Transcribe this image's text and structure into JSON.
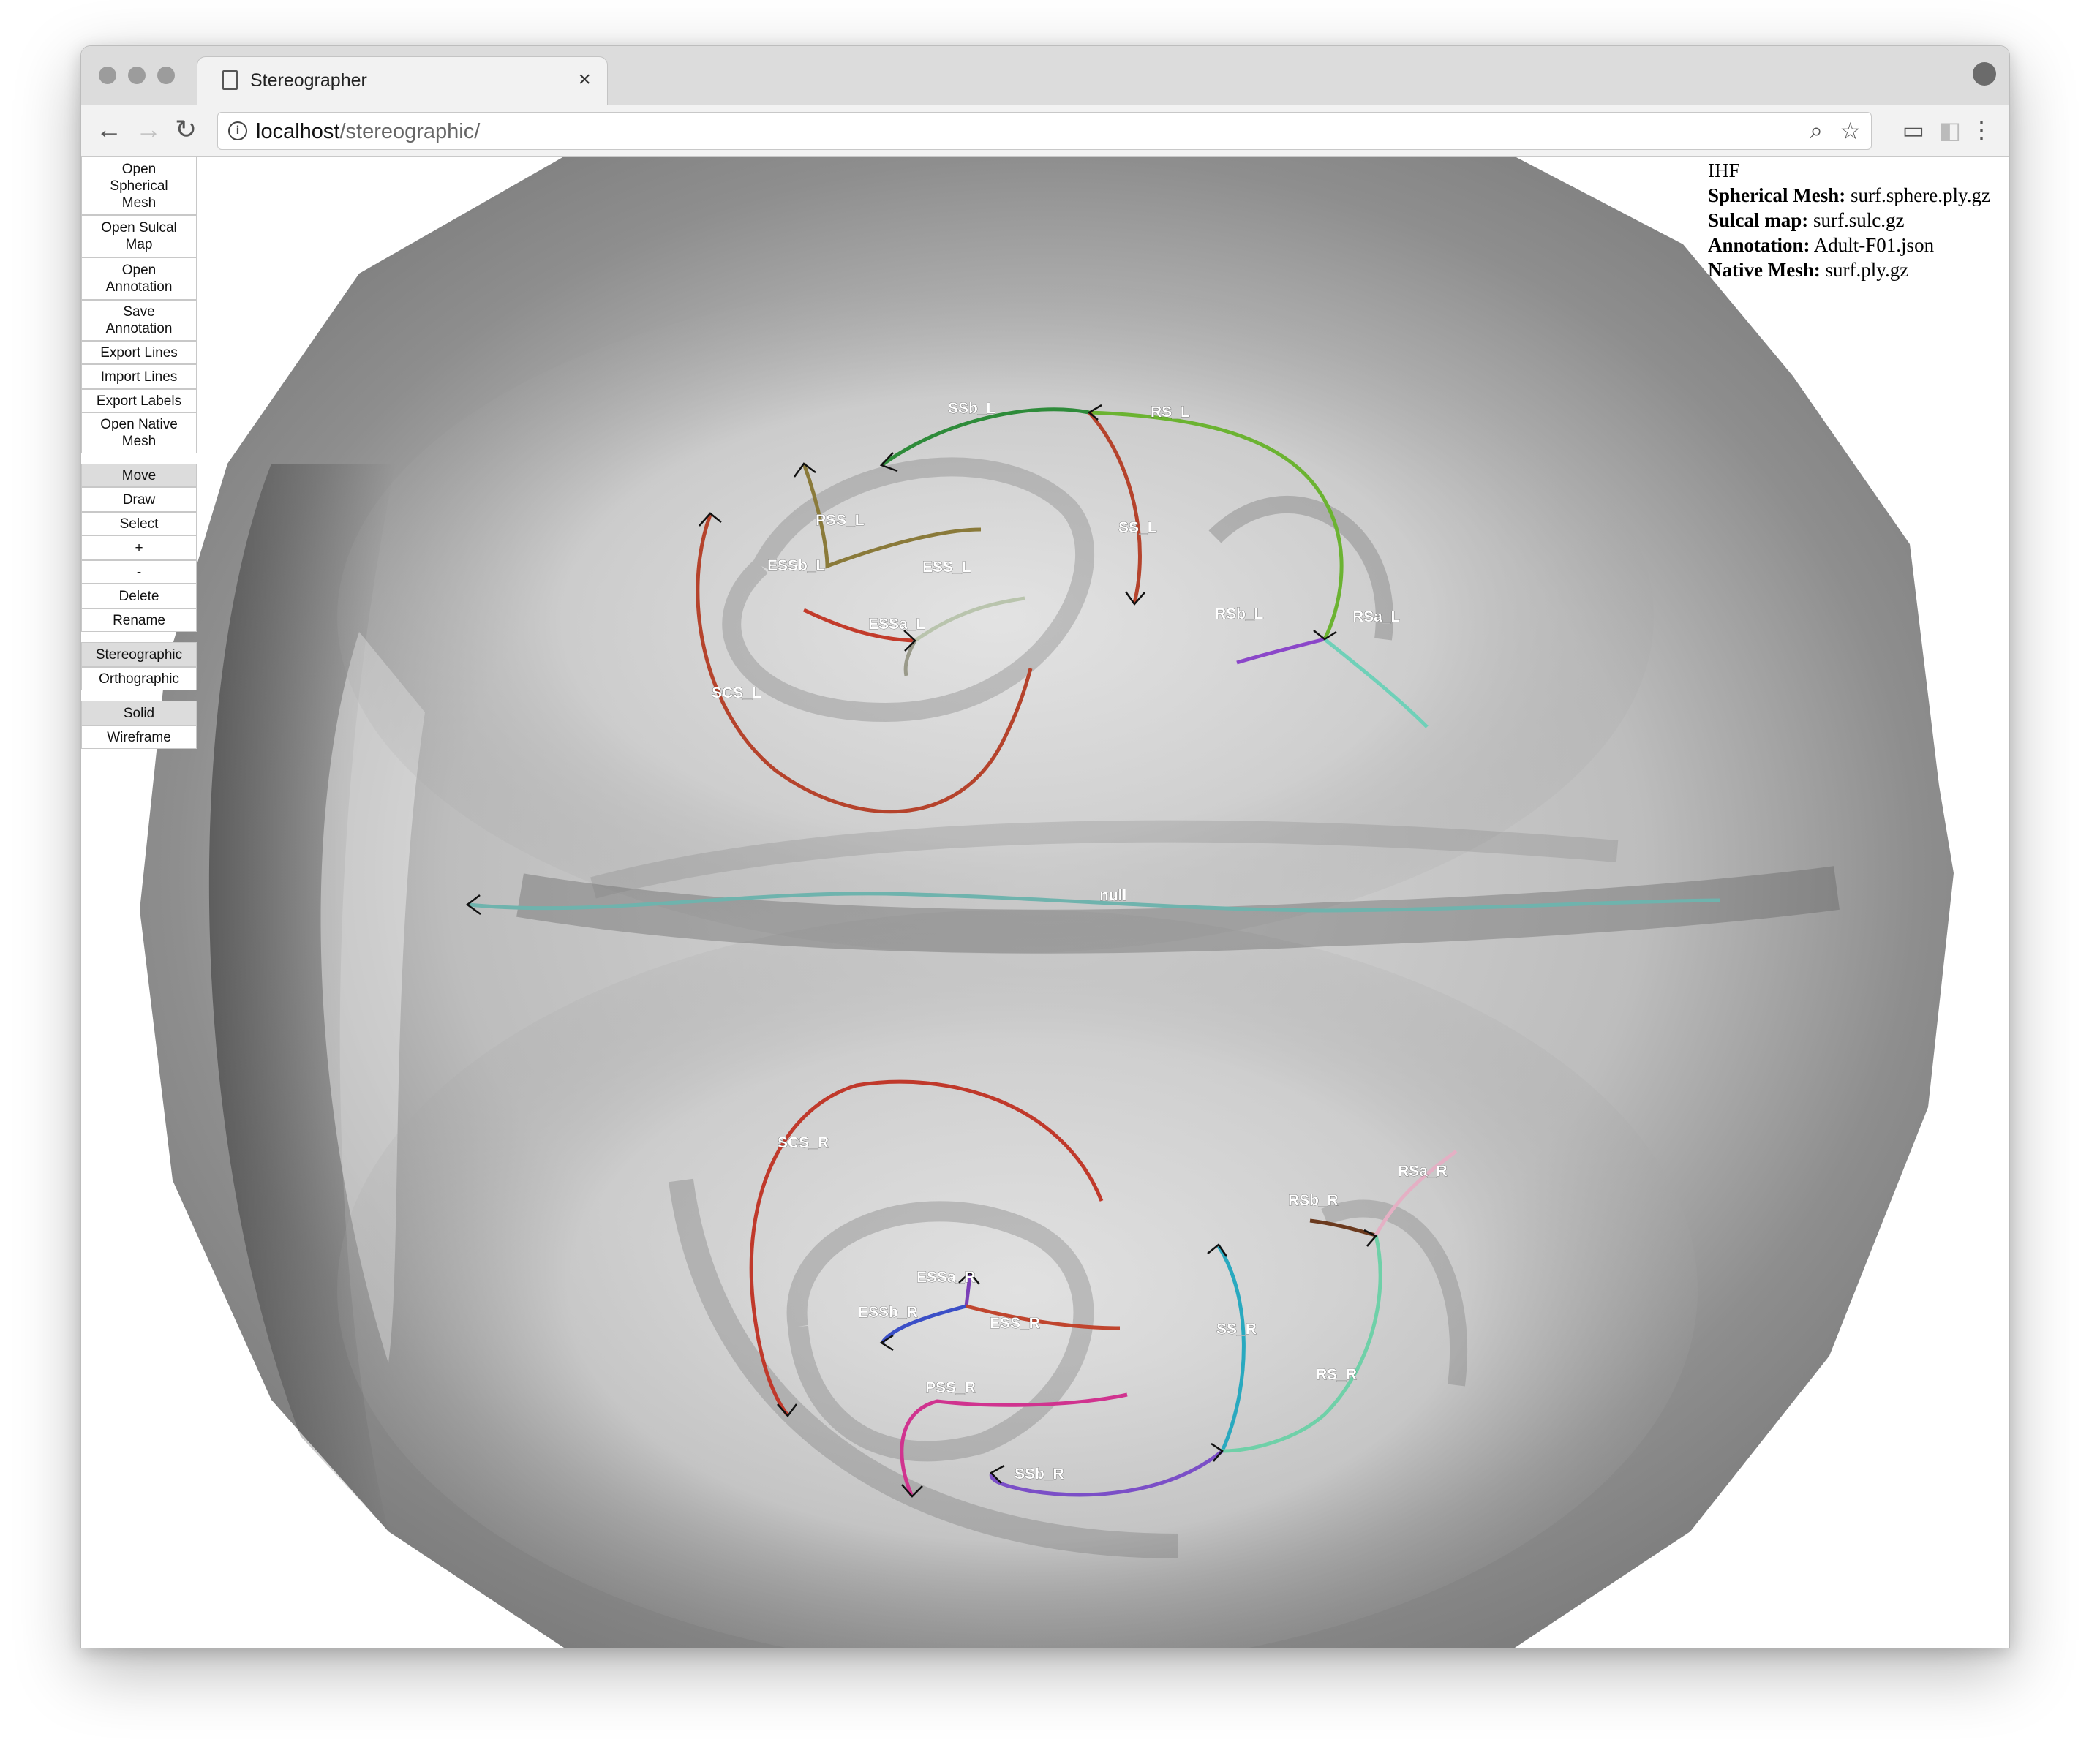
{
  "browser": {
    "tab_title": "Stereographer",
    "url_host": "localhost",
    "url_path": "/stereographic/"
  },
  "sidebar": {
    "file_buttons": [
      {
        "label": "Open\nSpherical\nMesh"
      },
      {
        "label": "Open Sulcal\nMap"
      },
      {
        "label": "Open\nAnnotation"
      },
      {
        "label": "Save\nAnnotation"
      },
      {
        "label": "Export Lines"
      },
      {
        "label": "Import Lines"
      },
      {
        "label": "Export Labels"
      },
      {
        "label": "Open Native\nMesh"
      }
    ],
    "tool_buttons": [
      {
        "label": "Move",
        "active": true
      },
      {
        "label": "Draw",
        "active": false
      },
      {
        "label": "Select",
        "active": false
      },
      {
        "label": "+",
        "active": false
      },
      {
        "label": "-",
        "active": false
      },
      {
        "label": "Delete",
        "active": false
      },
      {
        "label": "Rename",
        "active": false
      }
    ],
    "projection_buttons": [
      {
        "label": "Stereographic",
        "active": true
      },
      {
        "label": "Orthographic",
        "active": false
      }
    ],
    "render_buttons": [
      {
        "label": "Solid",
        "active": true
      },
      {
        "label": "Wireframe",
        "active": false
      }
    ]
  },
  "info": {
    "view": "IHF",
    "spherical_mesh_label": "Spherical Mesh:",
    "spherical_mesh": "surf.sphere.ply.gz",
    "sulcal_map_label": "Sulcal map:",
    "sulcal_map": "surf.sulc.gz",
    "annotation_label": "Annotation:",
    "annotation": "Adult-F01.json",
    "native_mesh_label": "Native Mesh:",
    "native_mesh": "surf.ply.gz"
  },
  "lines": [
    {
      "name": "SSb_L",
      "color": "#2e8b3a"
    },
    {
      "name": "RS_L",
      "color": "#6bb331"
    },
    {
      "name": "SS_L",
      "color": "#b5432c"
    },
    {
      "name": "PSS_L",
      "color": "#8a7a3a"
    },
    {
      "name": "ESSb_L",
      "color": "#c23b2b"
    },
    {
      "name": "ESS_L",
      "color": "#b9c4ad"
    },
    {
      "name": "ESSa_L",
      "color": "#9a9a8a"
    },
    {
      "name": "RSb_L",
      "color": "#8b47c9"
    },
    {
      "name": "RSa_L",
      "color": "#6fd0b8"
    },
    {
      "name": "SCS_L",
      "color": "#b5432c"
    },
    {
      "name": "null",
      "color": "#6fb3ad"
    },
    {
      "name": "SCS_R",
      "color": "#c0392b"
    },
    {
      "name": "RSb_R",
      "color": "#6b3a1e"
    },
    {
      "name": "RSa_R",
      "color": "#e4b0c4"
    },
    {
      "name": "ESSa_R",
      "color": "#7b3fb7"
    },
    {
      "name": "ESSb_R",
      "color": "#3b4fc7"
    },
    {
      "name": "ESS_R",
      "color": "#c0452e"
    },
    {
      "name": "SS_R",
      "color": "#29a9bf"
    },
    {
      "name": "PSS_R",
      "color": "#d0338f"
    },
    {
      "name": "RS_R",
      "color": "#6fd0a8"
    },
    {
      "name": "SSb_R",
      "color": "#7b4fc7"
    }
  ]
}
